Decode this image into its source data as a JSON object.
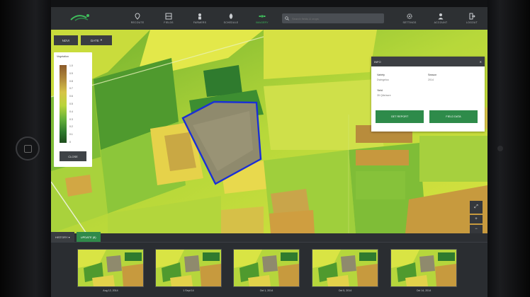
{
  "app": {
    "brand_mark": "farm-logo-icon"
  },
  "nav": [
    {
      "label": "RECOUTE",
      "icon": "pin-icon"
    },
    {
      "label": "FIELDS",
      "icon": "grid-icon"
    },
    {
      "label": "FARMERS",
      "icon": "person-icon"
    },
    {
      "label": "SCHEDULE",
      "icon": "leaf-icon"
    },
    {
      "label": "IMAGERY",
      "icon": "satellite-icon",
      "active": true
    }
  ],
  "search": {
    "placeholder": "Search fields & crops"
  },
  "right_nav": [
    {
      "label": "SETTINGS",
      "icon": "gear-icon"
    },
    {
      "label": "ACCOUNT",
      "icon": "user-icon"
    },
    {
      "label": "LOGOUT",
      "icon": "logout-icon"
    }
  ],
  "map_toolbar": {
    "layer": "NDVI",
    "view": "DATE"
  },
  "legend": {
    "title": "Vegetation",
    "ticks": [
      "1.0",
      "0.9",
      "0.8",
      "0.7",
      "0.6",
      "0.5",
      "0.4",
      "0.3",
      "0.2",
      "0.1",
      "0"
    ],
    "close": "CLOSE"
  },
  "info_panel": {
    "title": "INFO",
    "fields": [
      {
        "key": "Variety",
        "value": "Dwingeloo"
      },
      {
        "key": "Season",
        "value": "2014"
      },
      {
        "key": "Yield",
        "value": "35 Qtle/acre"
      }
    ],
    "btn_primary": "GET REPORT",
    "btn_secondary": "FIELD DATA"
  },
  "map_controls": {
    "fullscreen": "⤢",
    "zoom_in": "+",
    "zoom_out": "−"
  },
  "timeline": {
    "tabs": [
      "HISTORY ▾",
      "UPDATE (8)"
    ],
    "dates": [
      "Aug 12, 2014",
      "1 Sept 14",
      "Oct 1, 2014",
      "Oct 5, 2014",
      "Oct 14, 2014"
    ]
  },
  "colors": {
    "accent": "#2e8b4a",
    "bar": "#2d3033",
    "boundary": "#1a2fd6"
  }
}
